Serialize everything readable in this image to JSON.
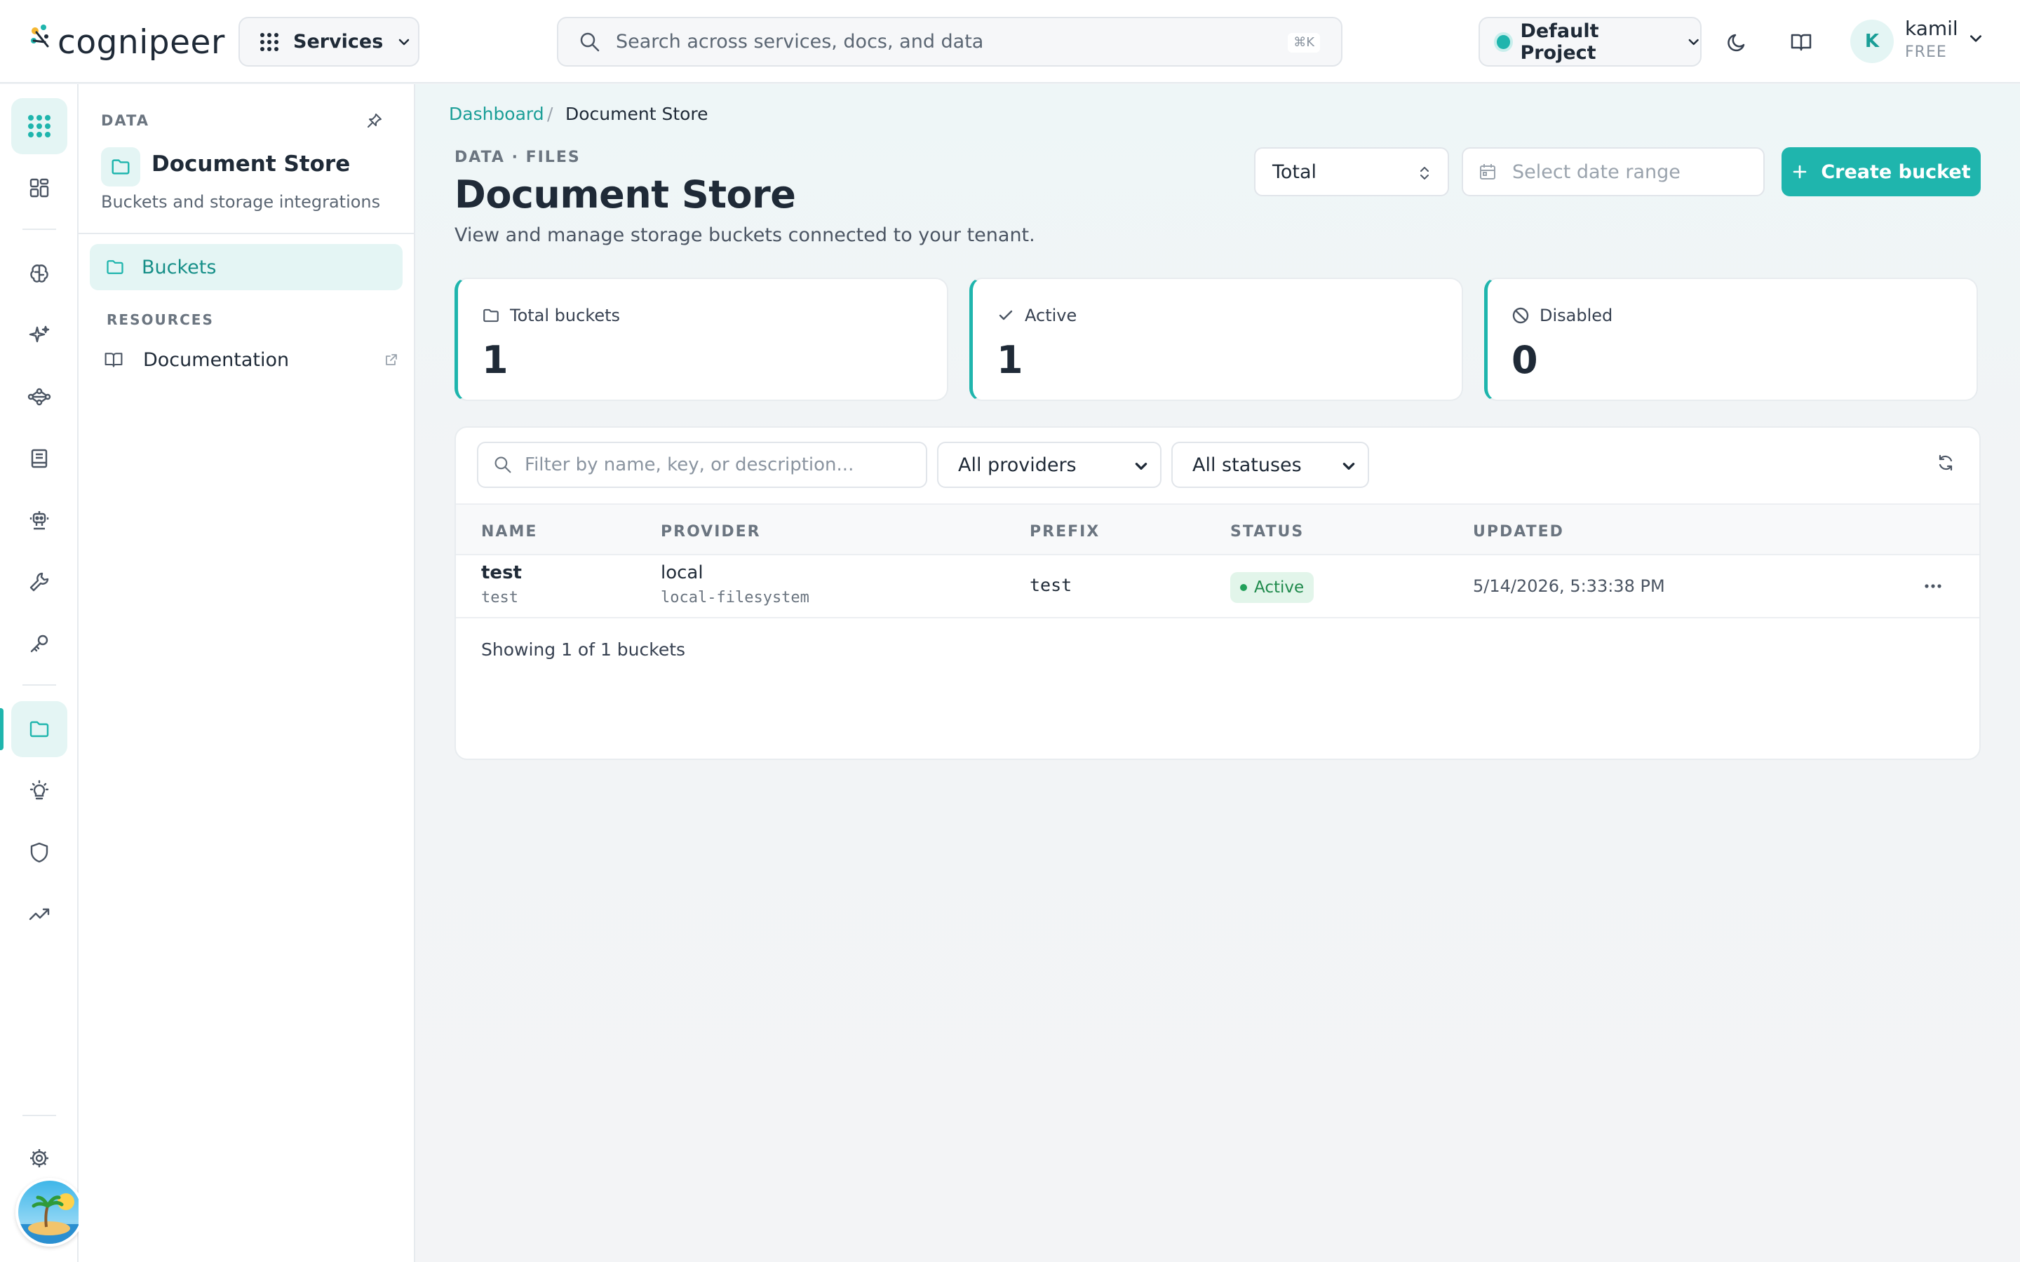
{
  "app": {
    "logo_text": "cognipeer",
    "accent_color": "#1fb5ad"
  },
  "topbar": {
    "services_label": "Services",
    "search_placeholder": "Search across services, docs, and data",
    "search_shortcut": "⌘K",
    "project_label": "Default Project",
    "user": {
      "initial": "K",
      "name": "kamil",
      "plan": "FREE"
    },
    "icons": [
      "grid-icon",
      "search-icon",
      "chevron-down-icon",
      "moon-icon",
      "book-icon"
    ]
  },
  "rail": {
    "items": [
      "apps-grid-icon",
      "dashboard-icon",
      "brain-icon",
      "sparkles-icon",
      "workflow-icon",
      "notebook-icon",
      "robot-icon",
      "tools-icon",
      "key-icon",
      "folder-icon",
      "lightbulb-icon",
      "shield-icon",
      "analytics-icon",
      "settings-icon"
    ]
  },
  "sidepanel": {
    "section": "DATA",
    "title": "Document Store",
    "subtitle": "Buckets and storage integrations",
    "nav_active": "Buckets",
    "resources_label": "RESOURCES",
    "documentation_label": "Documentation"
  },
  "main": {
    "breadcrumb": {
      "home": "Dashboard",
      "sep": "/",
      "current": "Document Store"
    },
    "eyebrow": "DATA · FILES",
    "title": "Document Store",
    "subtitle": "View and manage storage buckets connected to your tenant.",
    "total_select": "Total",
    "date_placeholder": "Select date range",
    "create_label": "Create bucket",
    "stats": [
      {
        "label": "Total buckets",
        "value": "1",
        "icon": "folder-icon"
      },
      {
        "label": "Active",
        "value": "1",
        "icon": "check-icon"
      },
      {
        "label": "Disabled",
        "value": "0",
        "icon": "ban-icon"
      }
    ],
    "filter_placeholder": "Filter by name, key, or description...",
    "provider_select": "All providers",
    "status_select": "All statuses",
    "columns": [
      "NAME",
      "PROVIDER",
      "PREFIX",
      "STATUS",
      "UPDATED"
    ],
    "rows": [
      {
        "name": "test",
        "key": "test",
        "provider": "local",
        "provider_type": "local-filesystem",
        "prefix": "test",
        "status": "Active",
        "updated": "5/14/2026, 5:33:38 PM"
      }
    ],
    "footer": "Showing 1 of 1 buckets"
  }
}
